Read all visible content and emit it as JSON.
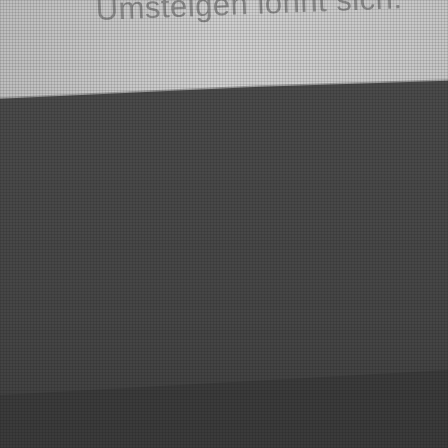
{
  "poster": {
    "slogan": "Umsteigen lohnt sich."
  },
  "colors": {
    "poster_paper": "#c8c8c8",
    "background_grey": "#484848",
    "lower_band": "#3c3c3c",
    "slogan_text": "#8a8a8a"
  }
}
